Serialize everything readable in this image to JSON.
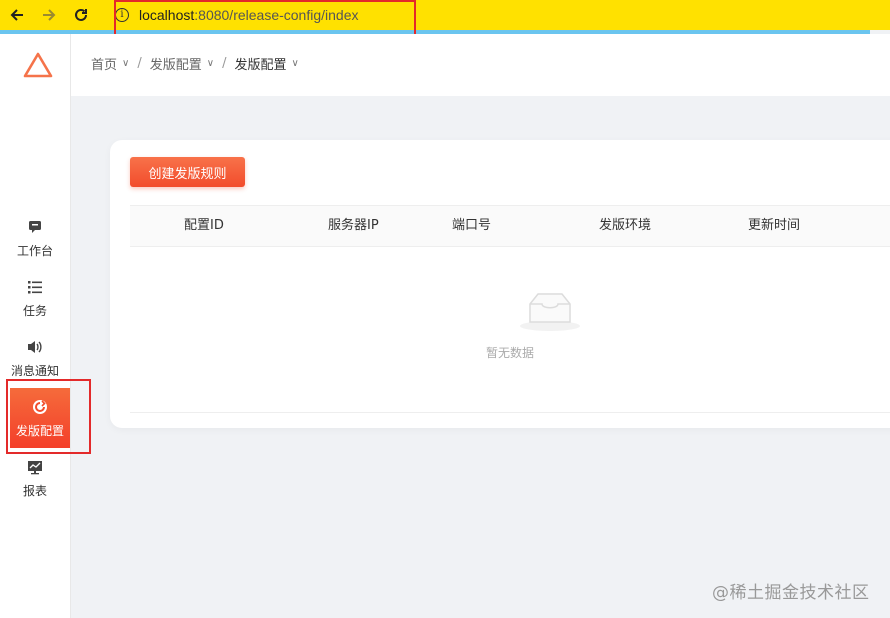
{
  "browser": {
    "url_host": "localhost",
    "url_path": ":8080/release-config/index"
  },
  "sidebar": {
    "items": [
      {
        "label": "工作台",
        "icon": "chat-icon"
      },
      {
        "label": "任务",
        "icon": "list-icon"
      },
      {
        "label": "消息通知",
        "icon": "speaker-icon"
      },
      {
        "label": "发版配置",
        "icon": "refresh-icon",
        "active": true
      },
      {
        "label": "报表",
        "icon": "chart-icon"
      }
    ]
  },
  "breadcrumb": [
    {
      "label": "首页"
    },
    {
      "label": "发版配置"
    },
    {
      "label": "发版配置"
    }
  ],
  "main": {
    "create_button": "创建发版规则",
    "columns": [
      "配置ID",
      "服务器IP",
      "端口号",
      "发版环境",
      "更新时间"
    ],
    "rows": [],
    "empty_text": "暂无数据"
  },
  "watermark": "@稀土掘金技术社区",
  "colors": {
    "browser_bar": "#ffe100",
    "accent": "#f24c2c",
    "highlight_box": "#e32a2a"
  }
}
